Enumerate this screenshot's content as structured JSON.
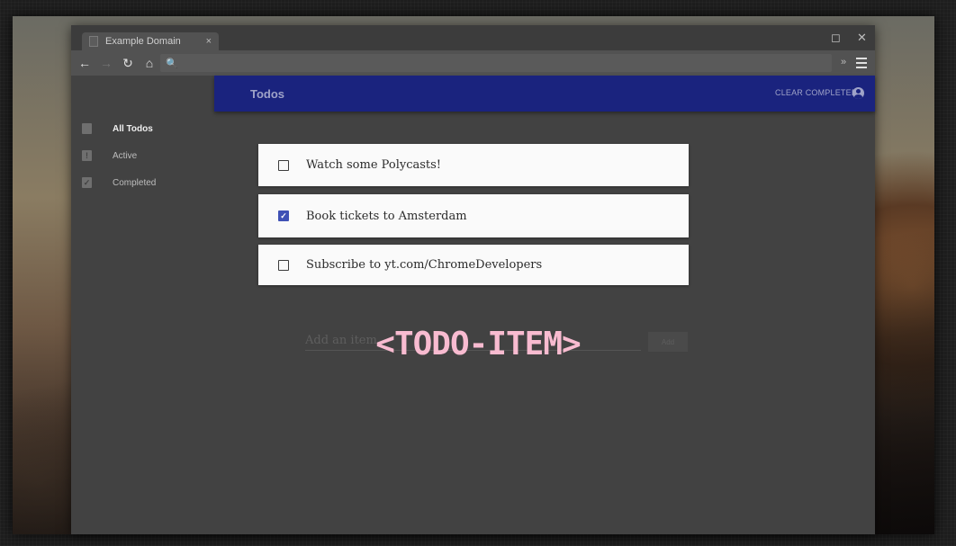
{
  "browser": {
    "tab_title": "Example Domain",
    "tab_close": "×",
    "restore_glyph": "◻",
    "close_glyph": "✕",
    "back_glyph": "←",
    "forward_glyph": "→",
    "reload_glyph": "↻",
    "home_glyph": "⌂",
    "search_glyph": "🔍",
    "address_value": "",
    "ext_chevron": "»"
  },
  "app": {
    "title": "Todos",
    "clear_completed": "CLEAR COMPLETED",
    "accent_color": "#1a237e"
  },
  "sidebar": {
    "items": [
      {
        "label": "All Todos",
        "icon": "clipboard-icon",
        "active": true
      },
      {
        "label": "Active",
        "icon": "clipboard-alert-icon",
        "active": false
      },
      {
        "label": "Completed",
        "icon": "check-box-icon",
        "active": false
      }
    ]
  },
  "todos": [
    {
      "text": "Watch some Polycasts!",
      "completed": false
    },
    {
      "text": "Book tickets to Amsterdam",
      "completed": true
    },
    {
      "text": "Subscribe to yt.com/ChromeDevelopers",
      "completed": false
    }
  ],
  "add_item": {
    "placeholder": "Add an item",
    "button_label": "Add"
  },
  "overlay": {
    "title": "<TODO-ITEM>",
    "color": "#f8bbd0"
  }
}
